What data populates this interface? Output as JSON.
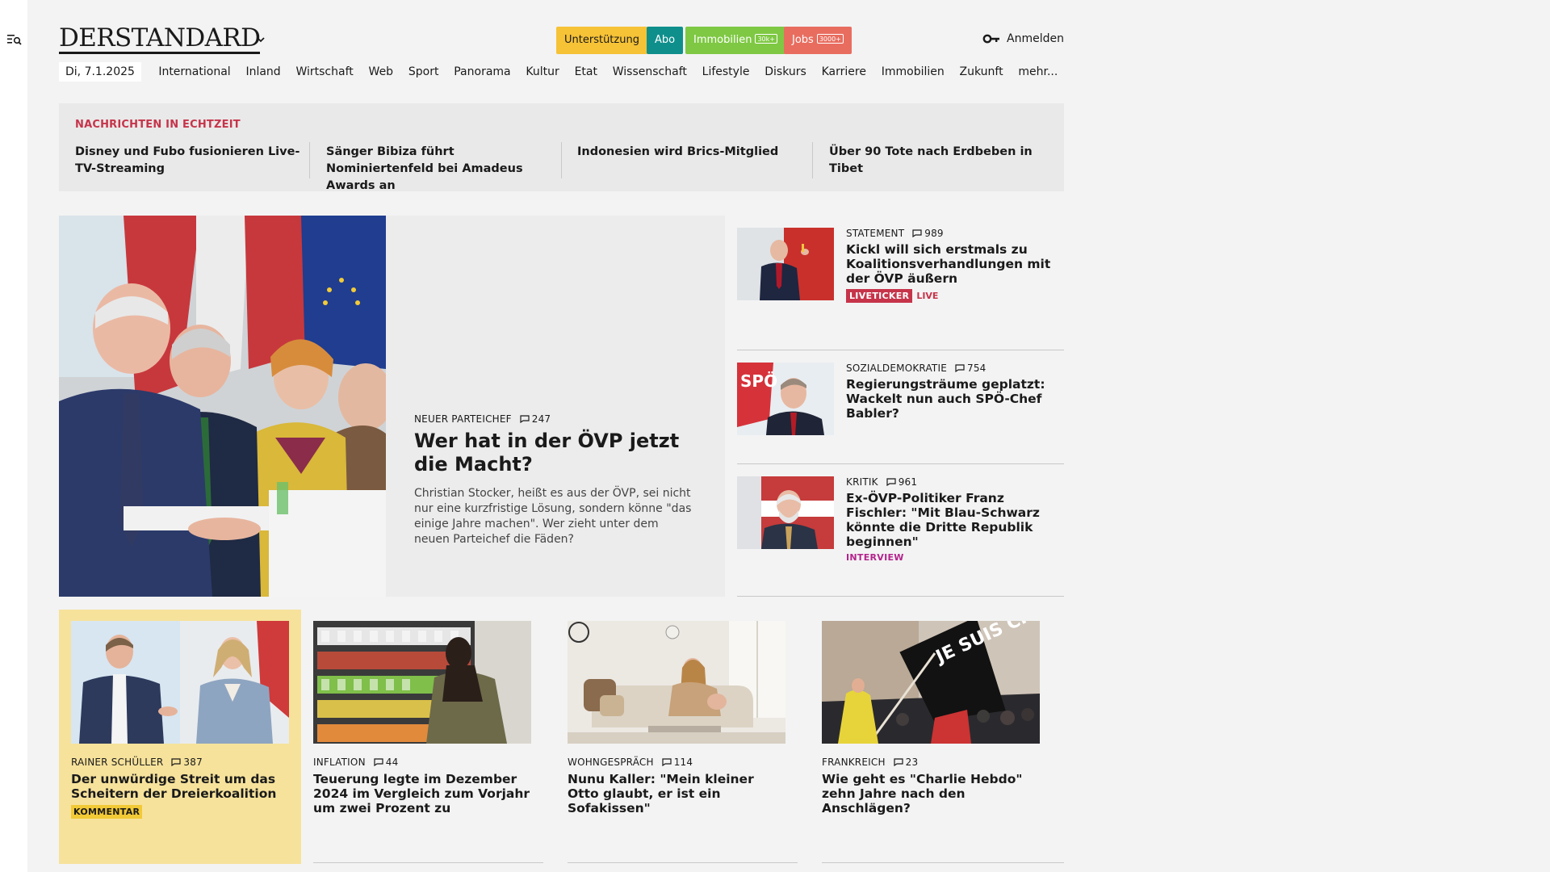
{
  "header": {
    "logo": "DERSTANDARD",
    "pills": {
      "support": "Unterstützung",
      "abo": "Abo",
      "immobilien": "Immobilien",
      "immobilien_tag": "30k+",
      "jobs": "Jobs",
      "jobs_tag": "3000+"
    },
    "login": "Anmelden"
  },
  "nav": {
    "date": "Di, 7.1.2025",
    "items": [
      "International",
      "Inland",
      "Wirtschaft",
      "Web",
      "Sport",
      "Panorama",
      "Kultur",
      "Etat",
      "Wissenschaft",
      "Lifestyle",
      "Diskurs",
      "Karriere",
      "Immobilien",
      "Zukunft",
      "mehr..."
    ]
  },
  "breaking": {
    "label": "NACHRICHTEN IN ECHTZEIT",
    "items": [
      "Disney und Fubo fusionieren Live-TV-Streaming",
      "Sänger Bibiza führt Nominiertenfeld bei Amadeus Awards an",
      "Indonesien wird Brics-Mitglied",
      "Über 90 Tote nach Erdbeben in Tibet"
    ]
  },
  "lead": {
    "kicker": "NEUER PARTEICHEF",
    "comments": "247",
    "title": "Wer hat in der ÖVP jetzt die Macht?",
    "teaser": "Christian Stocker, heißt es aus der ÖVP, sei nicht nur eine kurzfristige Lösung, sondern könne \"das einige Jahre machen\". Wer zieht unter dem neuen Parteichef die Fäden?"
  },
  "side": [
    {
      "kicker": "STATEMENT",
      "comments": "989",
      "title": "Kickl will sich erstmals zu Koali­tionsverhandlungen mit der ÖVP äußern",
      "badge": "LIVETICKER",
      "badge2": "LIVE"
    },
    {
      "kicker": "SOZIALDEMOKRATIE",
      "comments": "754",
      "title": "Regierungsträume geplatzt: Wackelt nun auch SPÖ-Chef Babler?"
    },
    {
      "kicker": "KRITIK",
      "comments": "961",
      "title": "Ex-ÖVP-Politiker Franz Fischler: \"Mit Blau-Schwarz könnte die Dritte Republik beginnen\"",
      "badge": "INTERVIEW"
    }
  ],
  "cards": [
    {
      "kicker": "RAINER SCHÜLLER",
      "comments": "387",
      "title": "Der unwürdige Streit um das Scheitern der Dreierkoalition",
      "badge": "KOMMENTAR"
    },
    {
      "kicker": "INFLATION",
      "comments": "44",
      "title": "Teuerung legte im Dezember 2024 im Vergleich zum Vorjahr um zwei Prozent zu"
    },
    {
      "kicker": "WOHNGESPRÄCH",
      "comments": "114",
      "title": "Nunu Kaller: \"Mein kleiner Otto glaubt, er ist ein Sofakissen\""
    },
    {
      "kicker": "FRANKREICH",
      "comments": "23",
      "title": "Wie geht es \"Charlie Hebdo\" zehn Jahre nach den Anschlägen?"
    }
  ],
  "flag_text": "JE SUIS CHARLIE",
  "colors": {
    "accent_red": "#c6344a",
    "support_yellow": "#f6c236",
    "abo_teal": "#0e8f8c",
    "immo_green": "#7ec843",
    "jobs_salmon": "#e86d5f",
    "comment_highlight": "#f6e29b"
  }
}
